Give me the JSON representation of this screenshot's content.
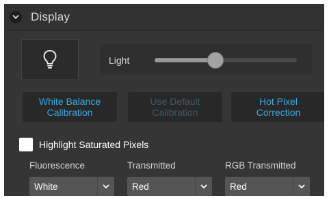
{
  "header": {
    "title": "Display",
    "collapse_icon": "chevron-down-icon"
  },
  "lamp": {
    "icon": "lightbulb-icon"
  },
  "light": {
    "label": "Light",
    "level_fraction": 0.43
  },
  "calibration": {
    "white_balance": "White Balance\nCalibration",
    "use_default": "Use Default\nCalibration",
    "hot_pixel": "Hot Pixel\nCorrection"
  },
  "highlight": {
    "label": "Highlight Saturated Pixels",
    "checked": false
  },
  "channels": [
    {
      "label": "Fluorescence",
      "value": "White"
    },
    {
      "label": "Transmitted",
      "value": "Red"
    },
    {
      "label": "RGB Transmitted",
      "value": "Red"
    }
  ],
  "colors": {
    "accent": "#39a9e6",
    "accent_disabled": "#3d5868",
    "panel_bg": "#353535"
  }
}
